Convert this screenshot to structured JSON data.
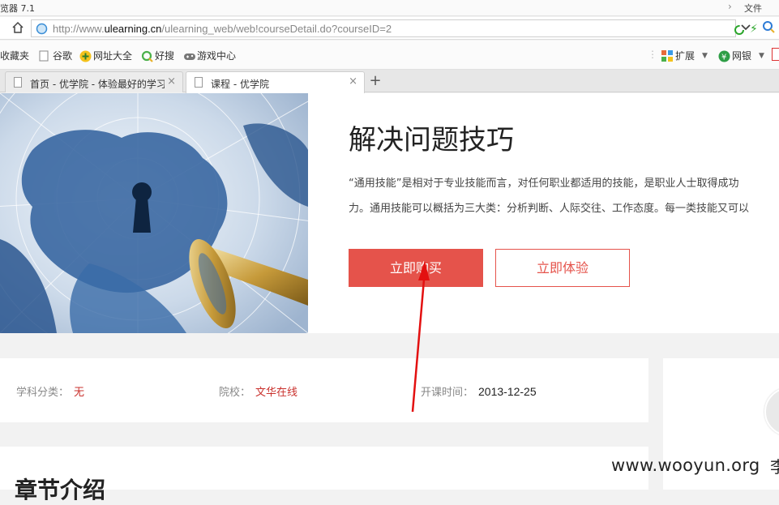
{
  "window": {
    "title": "览器 7.1",
    "file_menu": "文件"
  },
  "address": {
    "url_prefix": "http://www.",
    "url_domain": "ulearning.cn",
    "url_path": "/ulearning_web/web!courseDetail.do?courseID=2"
  },
  "bookmarks": {
    "items": [
      "收藏夹",
      "谷歌",
      "网址大全",
      "好搜",
      "游戏中心"
    ],
    "right": [
      "扩展",
      "网银"
    ]
  },
  "tabs": [
    {
      "label": "首页 - 优学院 - 体验最好的学习",
      "active": false
    },
    {
      "label": "课程 - 优学院",
      "active": true
    }
  ],
  "course": {
    "title": "解决问题技巧",
    "desc_line1": "“通用技能”是相对于专业技能而言，对任何职业都适用的技能，是职业人士取得成功",
    "desc_line2": "力。通用技能可以概括为三大类：分析判断、人际交往、工作态度。每一类技能又可以",
    "buy_label": "立即购买",
    "try_label": "立即体验"
  },
  "info": {
    "subject_key": "学科分类：",
    "subject_val": "无",
    "school_key": "院校：",
    "school_val": "文华在线",
    "start_key": "开课时间：",
    "start_val": "2013-12-25"
  },
  "chapters": {
    "title": "章节介绍"
  },
  "watermark": {
    "text": "www.wooyun.org",
    "tail": "李"
  },
  "colors": {
    "accent": "#e5534b",
    "link": "#c9302c"
  }
}
